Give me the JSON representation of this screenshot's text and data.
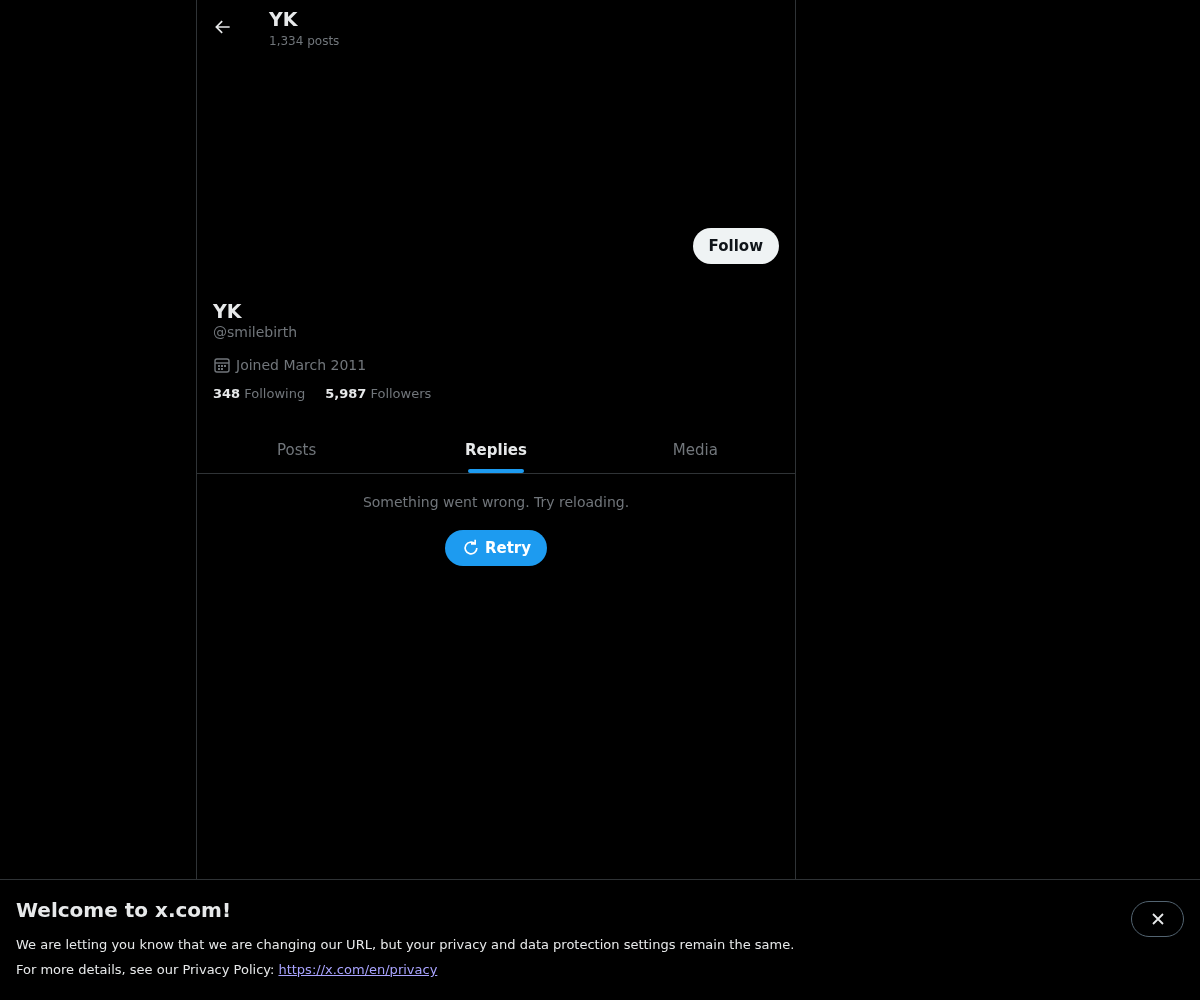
{
  "header": {
    "title": "YK",
    "post_count": "1,334 posts"
  },
  "follow_button": "Follow",
  "profile": {
    "name": "YK",
    "handle": "@smilebirth",
    "joined": "Joined March 2011",
    "stats": [
      "**348** Following",
      "**5,987** Followers"
    ]
  },
  "tabs": [
    {
      "label": "Posts",
      "selected": false
    },
    {
      "label": "Replies",
      "selected": true
    },
    {
      "label": "Media",
      "selected": false
    }
  ],
  "error": {
    "message": "Something went wrong. Try reloading.",
    "retry_button": "Retry"
  },
  "banner": {
    "title": "Welcome to x.com!",
    "text": "We are letting you know that we are changing our URL, but your privacy and data protection settings remain the same.",
    "policy_prefix": "For more details, see our Privacy Policy:",
    "policy_link": "https://x.com/en/privacy"
  }
}
